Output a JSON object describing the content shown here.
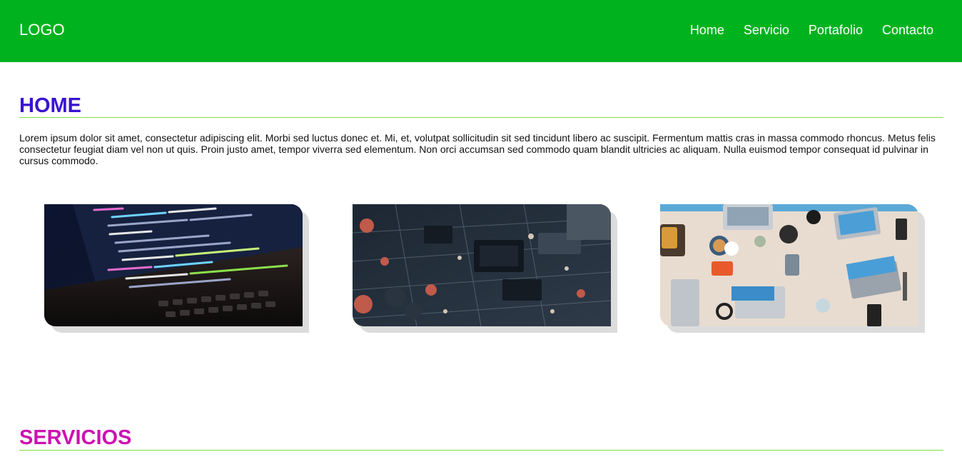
{
  "header": {
    "logo": "LOGO",
    "nav": [
      "Home",
      "Servicio",
      "Portafolio",
      "Contacto"
    ],
    "background_color": "#00b31e"
  },
  "home": {
    "title": "HOME",
    "title_color": "#3a12d4",
    "text": "Lorem ipsum dolor sit amet, consectetur adipiscing elit. Morbi sed luctus donec et. Mi, et, volutpat sollicitudin sit sed tincidunt libero ac suscipit. Fermentum mattis cras in massa commodo rhoncus. Metus felis consectetur feugiat diam vel non ut quis. Proin justo amet, tempor viverra sed elementum. Non orci accumsan sed commodo quam blandit ultricies ac aliquam. Nulla euismod tempor consequat id pulvinar in cursus commodo."
  },
  "gallery": [
    {
      "image": "laptop-code-screen"
    },
    {
      "image": "circuit-board"
    },
    {
      "image": "desk-with-laptops"
    }
  ],
  "servicios": {
    "title": "SERVICIOS",
    "title_color": "#cc12b0"
  },
  "rule_color": "#7fe03a"
}
